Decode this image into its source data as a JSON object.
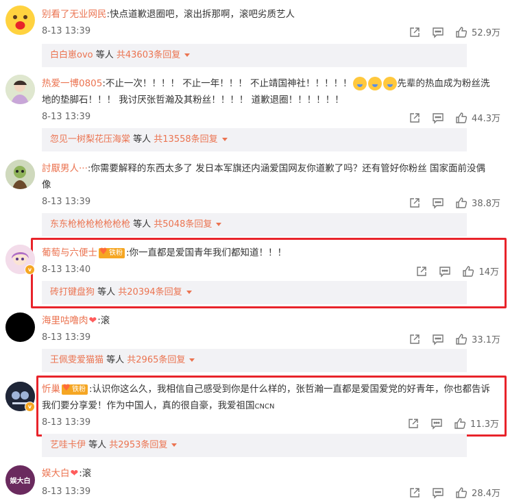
{
  "comments": [
    {
      "username": "别看了无业网民",
      "content": ":快点道歉退圈吧，滚出拆那啊，滚吧劣质艺人",
      "time": "8-13 13:39",
      "likes": "52.9万",
      "reply": {
        "user": "白白崽ovo",
        "mid": " 等人 ",
        "count": "共43603条回复"
      }
    },
    {
      "username": "热爱一博0805",
      "content_a": ":不止一次！！！！ 不止一年！！！ 不止靖国神社！！！！！",
      "content_b": "先辈的热血成为粉丝洗地的垫脚石！！！ 我讨厌张哲瀚及其粉丝！！！！ 道歉退圈！！！！！！",
      "time": "8-13 13:39",
      "likes": "44.3万",
      "reply": {
        "user": "忽见一树梨花压海棠",
        "mid": " 等人 ",
        "count": "共13558条回复"
      }
    },
    {
      "username": "討厭男人···",
      "content": ":你需要解释的东西太多了 发日本军旗还内涵爱国网友你道歉了吗？还有管好你粉丝 国家面前没偶像",
      "time": "8-13 13:39",
      "likes": "38.8万",
      "reply": {
        "user": "东东枪枪枪枪枪枪枪",
        "mid": " 等人 ",
        "count": "共5048条回复"
      }
    },
    {
      "username": "葡萄与六便士",
      "badge": "铁粉",
      "content": ":你一直都是爱国青年我们都知道！！！",
      "time": "8-13 13:40",
      "likes": "14万",
      "reply": {
        "user": "砖打键盘狗",
        "mid": " 等人 ",
        "count": "共20394条回复"
      }
    },
    {
      "username": "海里咕噜肉",
      "content": ":滚",
      "time": "8-13 13:39",
      "likes": "33.1万",
      "reply": {
        "user": "王佩雯爱猫猫",
        "mid": " 等人 ",
        "count": "共2965条回复"
      }
    },
    {
      "username": "忻巢",
      "badge": "铁粉",
      "content": ":认识你这么久，我相信自己感受到你是什么样的，张哲瀚一直都是爱国爱党的好青年，你也都告诉我们要分享爱！作为中国人，真的很自豪，我爱祖国",
      "content_tail": "CNCN",
      "time": "8-13 13:39",
      "likes": "11.3万",
      "reply": {
        "user": "艺哇卡伊",
        "mid": " 等人 ",
        "count": "共2953条回复"
      }
    },
    {
      "username": "娱大白",
      "content": ":滚",
      "time": "8-13 13:39",
      "likes": "28.4万"
    }
  ],
  "avatar_texts": {
    "yudabai": "娱大白"
  },
  "colors": {
    "username": "#eb7350",
    "highlight": "#e8232a",
    "reply_bg": "#f2f2f5"
  }
}
